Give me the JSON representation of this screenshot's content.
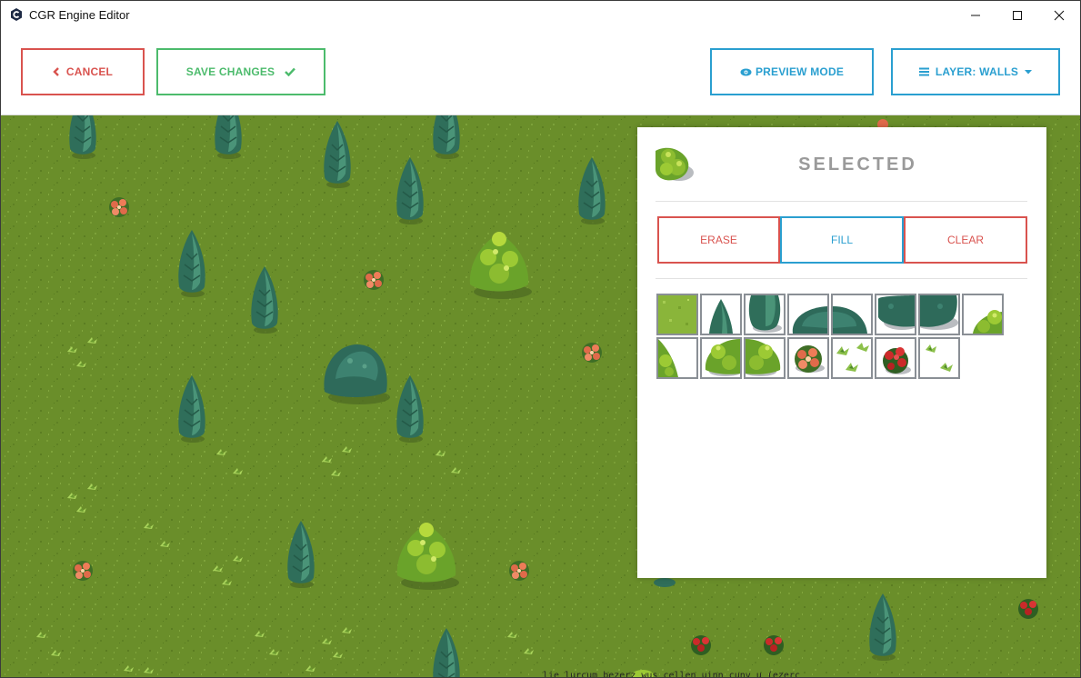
{
  "window": {
    "title": "CGR Engine Editor",
    "controls": [
      "minimize",
      "maximize",
      "close"
    ]
  },
  "toolbar": {
    "cancel_label": "CANCEL",
    "cancel_icon": "chevron-left-icon",
    "save_label": "SAVE CHANGES",
    "save_icon": "check-icon",
    "preview_label": "PREVIEW MODE",
    "preview_icon": "eye-icon",
    "layer_label": "LAYER: WALLS",
    "layer_icon": "bars-icon",
    "layer_caret": "caret-down-icon"
  },
  "panel": {
    "title": "SELECTED",
    "actions": {
      "erase": "ERASE",
      "fill": "FILL",
      "clear": "CLEAR"
    },
    "tiles": [
      "grass-tile",
      "pine-tree-top-tile",
      "pine-tree-bottom-tile",
      "round-bush-left-tile",
      "round-bush-right-tile",
      "dark-bush-left-tile",
      "dark-bush-right-tile",
      "light-bush-corner-tile",
      "light-bush-edge-tile",
      "light-bush-left-tile",
      "light-bush-right-tile",
      "red-flower-bush-tile",
      "grass-tufts-tile",
      "red-rose-tile",
      "small-sprouts-tile"
    ]
  },
  "map": {
    "bottom_text": "lie lurcum bezerz wus cellen uinn cunv u (ezerc"
  },
  "colors": {
    "cancel": "#d9534f",
    "save": "#4cbb6c",
    "primary": "#2a9fd0",
    "grass": "#6a8e2a"
  }
}
